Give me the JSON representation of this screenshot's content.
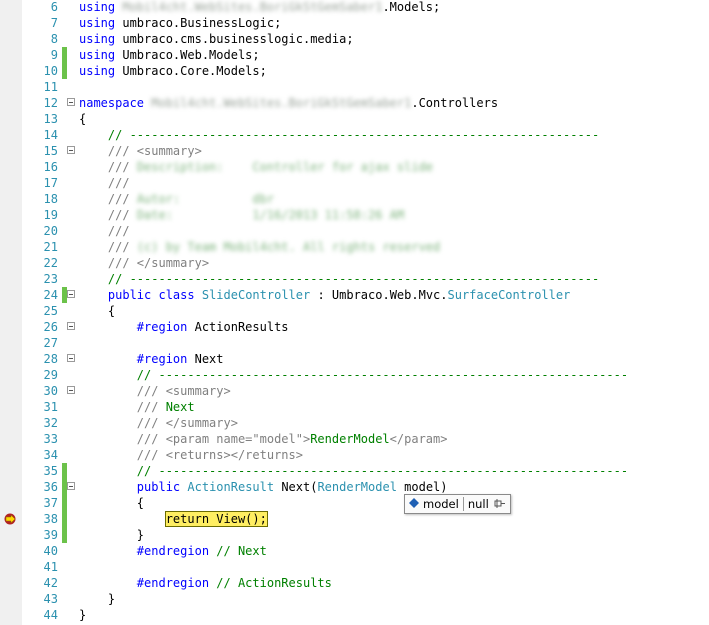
{
  "editor": {
    "lines": [
      {
        "num": "6",
        "saved": false,
        "tokens": [
          [
            "kw",
            "using"
          ],
          [
            "pl",
            " "
          ],
          [
            "blur",
            "Mobil4cht.WebSites.BoriGkStGemSaber1"
          ],
          [
            "pl",
            ".Models;"
          ]
        ]
      },
      {
        "num": "7",
        "saved": false,
        "tokens": [
          [
            "kw",
            "using"
          ],
          [
            "pl",
            " umbraco.BusinessLogic;"
          ]
        ]
      },
      {
        "num": "8",
        "saved": false,
        "tokens": [
          [
            "kw",
            "using"
          ],
          [
            "pl",
            " umbraco.cms.businesslogic.media;"
          ]
        ]
      },
      {
        "num": "9",
        "saved": true,
        "tokens": [
          [
            "kw",
            "using"
          ],
          [
            "pl",
            " Umbraco.Web.Models;"
          ]
        ]
      },
      {
        "num": "10",
        "saved": true,
        "tokens": [
          [
            "kw",
            "using"
          ],
          [
            "pl",
            " Umbraco.Core.Models;"
          ]
        ]
      },
      {
        "num": "11",
        "saved": false,
        "tokens": []
      },
      {
        "num": "12",
        "saved": false,
        "fold": true,
        "tokens": [
          [
            "kw",
            "namespace"
          ],
          [
            "pl",
            " "
          ],
          [
            "blur",
            "Mobil4cht.WebSites.BoriGkStGemSaber1"
          ],
          [
            "pl",
            ".Controllers"
          ]
        ]
      },
      {
        "num": "13",
        "saved": false,
        "tokens": [
          [
            "pl",
            "{"
          ]
        ]
      },
      {
        "num": "14",
        "saved": false,
        "tokens": [
          [
            "pl",
            "    "
          ],
          [
            "cm",
            "// -----------------------------------------------------------------"
          ]
        ]
      },
      {
        "num": "15",
        "saved": false,
        "fold": true,
        "tokens": [
          [
            "pl",
            "    "
          ],
          [
            "xd",
            "/// <summary>"
          ]
        ]
      },
      {
        "num": "16",
        "saved": false,
        "tokens": [
          [
            "pl",
            "    "
          ],
          [
            "xd",
            "/// "
          ],
          [
            "blurc",
            "Description:    Controller for ajax slide"
          ]
        ]
      },
      {
        "num": "17",
        "saved": false,
        "tokens": [
          [
            "pl",
            "    "
          ],
          [
            "xd",
            "///"
          ]
        ]
      },
      {
        "num": "18",
        "saved": false,
        "tokens": [
          [
            "pl",
            "    "
          ],
          [
            "xd",
            "/// "
          ],
          [
            "blurc",
            "Autor:          dbr"
          ]
        ]
      },
      {
        "num": "19",
        "saved": false,
        "tokens": [
          [
            "pl",
            "    "
          ],
          [
            "xd",
            "/// "
          ],
          [
            "blurc",
            "Date:           1/16/2013 11:58:26 AM"
          ]
        ]
      },
      {
        "num": "20",
        "saved": false,
        "tokens": [
          [
            "pl",
            "    "
          ],
          [
            "xd",
            "///"
          ]
        ]
      },
      {
        "num": "21",
        "saved": false,
        "tokens": [
          [
            "pl",
            "    "
          ],
          [
            "xd",
            "/// "
          ],
          [
            "blurc",
            "(c) by Team Mobil4cht. All rights reserved"
          ]
        ]
      },
      {
        "num": "22",
        "saved": false,
        "tokens": [
          [
            "pl",
            "    "
          ],
          [
            "xd",
            "/// </summary>"
          ]
        ]
      },
      {
        "num": "23",
        "saved": false,
        "tokens": [
          [
            "pl",
            "    "
          ],
          [
            "cm",
            "// -----------------------------------------------------------------"
          ]
        ]
      },
      {
        "num": "24",
        "saved": true,
        "fold": true,
        "tokens": [
          [
            "pl",
            "    "
          ],
          [
            "kw",
            "public class"
          ],
          [
            "pl",
            " "
          ],
          [
            "ty",
            "SlideController"
          ],
          [
            "pl",
            " : Umbraco.Web.Mvc."
          ],
          [
            "ty",
            "SurfaceController"
          ]
        ]
      },
      {
        "num": "25",
        "saved": false,
        "tokens": [
          [
            "pl",
            "    {"
          ]
        ]
      },
      {
        "num": "26",
        "saved": false,
        "fold": true,
        "tokens": [
          [
            "pl",
            "        "
          ],
          [
            "kw",
            "#region"
          ],
          [
            "pl",
            " ActionResults"
          ]
        ]
      },
      {
        "num": "27",
        "saved": false,
        "tokens": []
      },
      {
        "num": "28",
        "saved": false,
        "fold": true,
        "tokens": [
          [
            "pl",
            "        "
          ],
          [
            "kw",
            "#region"
          ],
          [
            "pl",
            " Next"
          ]
        ]
      },
      {
        "num": "29",
        "saved": false,
        "tokens": [
          [
            "pl",
            "        "
          ],
          [
            "cm",
            "// -----------------------------------------------------------------"
          ]
        ]
      },
      {
        "num": "30",
        "saved": false,
        "fold": true,
        "tokens": [
          [
            "pl",
            "        "
          ],
          [
            "xd",
            "/// <summary>"
          ]
        ]
      },
      {
        "num": "31",
        "saved": false,
        "tokens": [
          [
            "pl",
            "        "
          ],
          [
            "xd",
            "/// "
          ],
          [
            "cm",
            "Next"
          ]
        ]
      },
      {
        "num": "32",
        "saved": false,
        "tokens": [
          [
            "pl",
            "        "
          ],
          [
            "xd",
            "/// </summary>"
          ]
        ]
      },
      {
        "num": "33",
        "saved": false,
        "tokens": [
          [
            "pl",
            "        "
          ],
          [
            "xd",
            "/// <param name=\"model\">"
          ],
          [
            "cm",
            "RenderModel"
          ],
          [
            "xd",
            "</param>"
          ]
        ]
      },
      {
        "num": "34",
        "saved": false,
        "tokens": [
          [
            "pl",
            "        "
          ],
          [
            "xd",
            "/// <returns></returns>"
          ]
        ]
      },
      {
        "num": "35",
        "saved": true,
        "tokens": [
          [
            "pl",
            "        "
          ],
          [
            "cm",
            "// -----------------------------------------------------------------"
          ]
        ]
      },
      {
        "num": "36",
        "saved": true,
        "fold": true,
        "tokens": [
          [
            "pl",
            "        "
          ],
          [
            "kw",
            "public"
          ],
          [
            "pl",
            " "
          ],
          [
            "ty",
            "ActionResult"
          ],
          [
            "pl",
            " Next("
          ],
          [
            "ty",
            "RenderModel"
          ],
          [
            "pl",
            " model)"
          ]
        ]
      },
      {
        "num": "37",
        "saved": true,
        "tokens": [
          [
            "pl",
            "        {"
          ]
        ]
      },
      {
        "num": "38",
        "saved": true,
        "bp": true,
        "tokens": [
          [
            "pl",
            "            "
          ],
          [
            "hl",
            "return View();"
          ]
        ]
      },
      {
        "num": "39",
        "saved": true,
        "tokens": [
          [
            "pl",
            "        }"
          ]
        ]
      },
      {
        "num": "40",
        "saved": false,
        "tokens": [
          [
            "pl",
            "        "
          ],
          [
            "kw",
            "#endregion"
          ],
          [
            "pl",
            " "
          ],
          [
            "cm",
            "// Next"
          ]
        ]
      },
      {
        "num": "41",
        "saved": false,
        "tokens": []
      },
      {
        "num": "42",
        "saved": false,
        "tokens": [
          [
            "pl",
            "        "
          ],
          [
            "kw",
            "#endregion"
          ],
          [
            "pl",
            " "
          ],
          [
            "cm",
            "// ActionResults"
          ]
        ]
      },
      {
        "num": "43",
        "saved": false,
        "tokens": [
          [
            "pl",
            "    }"
          ]
        ]
      },
      {
        "num": "44",
        "saved": false,
        "tokens": [
          [
            "pl",
            "}"
          ]
        ]
      }
    ]
  },
  "datatip": {
    "name": "model",
    "value": "null"
  },
  "colors": {
    "keyword": "#0000ff",
    "comment": "#008000",
    "type": "#2b91af",
    "linenum": "#2b91af",
    "highlight": "#ffee62"
  }
}
